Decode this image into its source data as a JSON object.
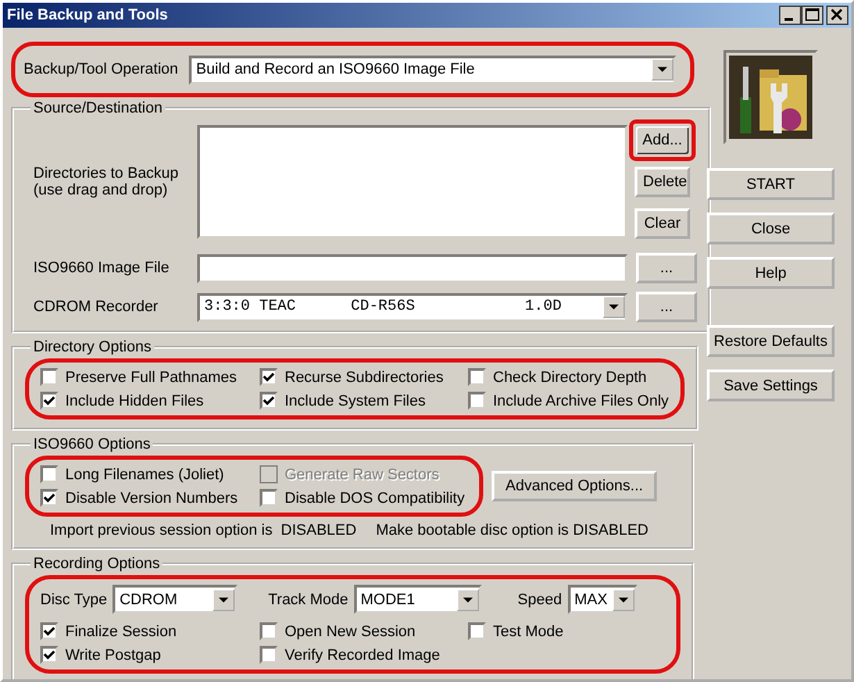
{
  "window": {
    "title": "File Backup and Tools"
  },
  "operation": {
    "label": "Backup/Tool Operation",
    "value": "Build and Record an ISO9660 Image File",
    "highlighted": true
  },
  "source": {
    "title": "Source/Destination",
    "directories_label": "Directories to Backup\n(use drag and drop)",
    "buttons": [
      {
        "label": "Add...",
        "highlighted": true
      },
      {
        "label": "Delete",
        "highlighted": false
      },
      {
        "label": "Clear",
        "highlighted": false
      }
    ],
    "image_file": {
      "label": "ISO9660 Image File",
      "browse": "..."
    },
    "recorder": {
      "label": "CDROM Recorder",
      "value": "3:3:0 TEAC      CD-R56S            1.0D",
      "browse": "..."
    }
  },
  "directory_options": {
    "title": "Directory Options",
    "highlighted": true,
    "options": [
      {
        "label": "Preserve Full Pathnames",
        "checked": false,
        "disabled": false
      },
      {
        "label": "Recurse Subdirectories",
        "checked": true,
        "disabled": false
      },
      {
        "label": "Check Directory Depth",
        "checked": false,
        "disabled": false
      },
      {
        "label": "Include Hidden Files",
        "checked": true,
        "disabled": false
      },
      {
        "label": "Include System Files",
        "checked": true,
        "disabled": false
      },
      {
        "label": "Include Archive Files Only",
        "checked": false,
        "disabled": false
      }
    ]
  },
  "iso_options": {
    "title": "ISO9660 Options",
    "highlighted": true,
    "options": [
      {
        "label": "Long Filenames (Joliet)",
        "checked": false,
        "disabled": false
      },
      {
        "label": "Generate Raw Sectors",
        "checked": false,
        "disabled": true
      },
      {
        "label": "Disable Version Numbers",
        "checked": true,
        "disabled": false
      },
      {
        "label": "Disable DOS Compatibility",
        "checked": false,
        "disabled": false
      }
    ],
    "advanced_button": "Advanced Options...",
    "status": [
      "Import previous session option is  DISABLED",
      "Make bootable disc option is DISABLED"
    ]
  },
  "recording": {
    "title": "Recording Options",
    "highlighted": true,
    "fields": [
      {
        "label": "Disc Type",
        "value": "CDROM"
      },
      {
        "label": "Track Mode",
        "value": "MODE1"
      },
      {
        "label": "Speed",
        "value": "MAX"
      }
    ],
    "options": [
      {
        "label": "Finalize Session",
        "checked": true,
        "disabled": false
      },
      {
        "label": "Open New Session",
        "checked": false,
        "disabled": false
      },
      {
        "label": "Test Mode",
        "checked": false,
        "disabled": false
      },
      {
        "label": "Write Postgap",
        "checked": true,
        "disabled": false
      },
      {
        "label": "Verify Recorded Image",
        "checked": false,
        "disabled": false
      }
    ]
  },
  "side_buttons": [
    "START",
    "Close",
    "Help",
    "Restore Defaults",
    "Save Settings"
  ]
}
